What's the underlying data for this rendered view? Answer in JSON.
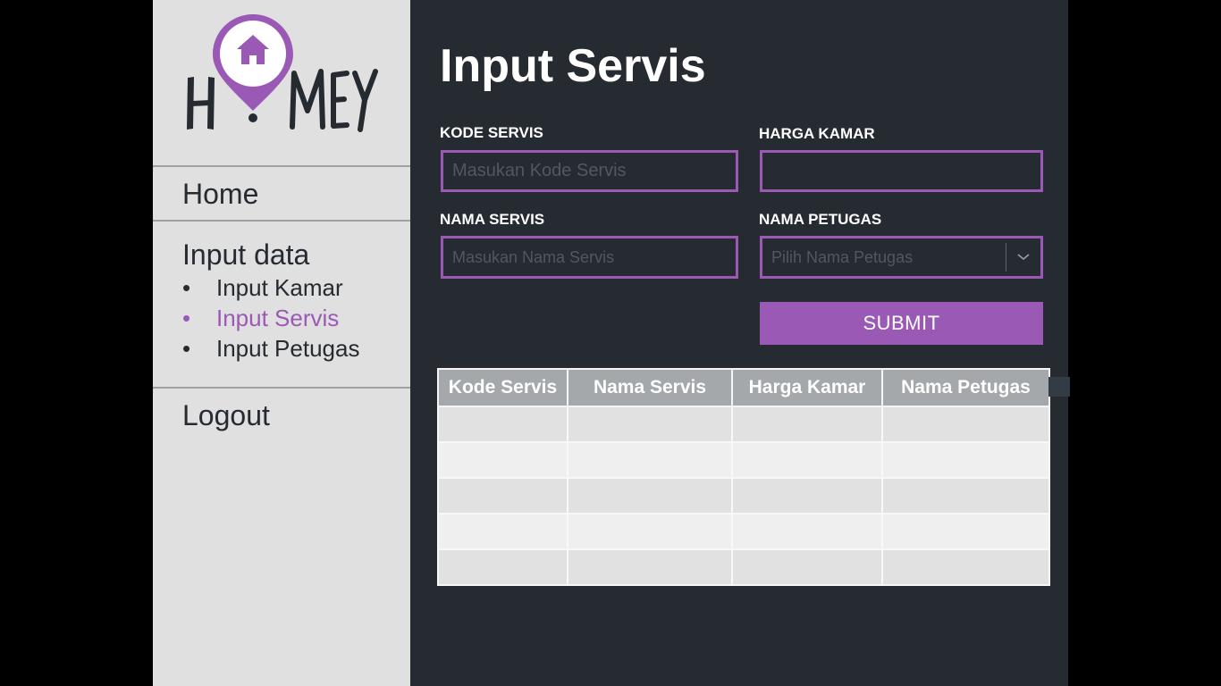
{
  "app": {
    "logo_text": "HOMEY",
    "accent_color": "#9b59b6"
  },
  "sidebar": {
    "home": "Home",
    "input_data": "Input data",
    "items": [
      {
        "label": "Input Kamar",
        "active": false
      },
      {
        "label": "Input Servis",
        "active": true
      },
      {
        "label": "Input Petugas",
        "active": false
      }
    ],
    "bullet": "•",
    "logout": "Logout"
  },
  "main": {
    "title": "Input Servis",
    "form": {
      "kode_label": "KODE SERVIS",
      "kode_placeholder": "Masukan Kode Servis",
      "kode_value": "",
      "harga_label": "HARGA KAMAR",
      "harga_value": "",
      "nama_label": "NAMA SERVIS",
      "nama_placeholder": "Masukan Nama Servis",
      "nama_value": "",
      "petugas_label": "NAMA PETUGAS",
      "petugas_placeholder": "Pilih Nama Petugas",
      "submit_label": "SUBMIT"
    },
    "table": {
      "headers": [
        "Kode Servis",
        "Nama Servis",
        "Harga Kamar",
        "Nama Petugas"
      ],
      "rows": [
        [
          "",
          "",
          "",
          ""
        ],
        [
          "",
          "",
          "",
          ""
        ],
        [
          "",
          "",
          "",
          ""
        ],
        [
          "",
          "",
          "",
          ""
        ],
        [
          "",
          "",
          "",
          ""
        ]
      ]
    }
  }
}
